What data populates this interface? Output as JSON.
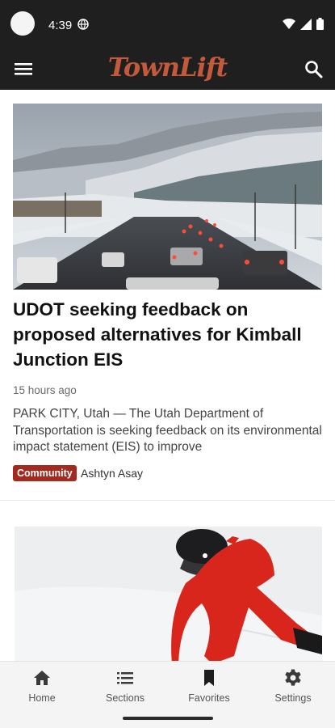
{
  "status_bar": {
    "time": "4:39"
  },
  "app_bar": {
    "logo_text": "TownLift"
  },
  "articles": [
    {
      "headline": "UDOT seeking feedback on proposed alternatives for Kimball Junction EIS",
      "time_ago": "15 hours ago",
      "excerpt": "PARK CITY, Utah — The Utah Department of Transportation is seeking feedback on its environmental impact statement (EIS) to improve",
      "category": "Community",
      "author": "Ashtyn Asay"
    }
  ],
  "bottom_nav": [
    {
      "label": "Home",
      "icon": "home-icon"
    },
    {
      "label": "Sections",
      "icon": "list-icon"
    },
    {
      "label": "Favorites",
      "icon": "bookmark-icon"
    },
    {
      "label": "Settings",
      "icon": "gear-icon"
    }
  ],
  "colors": {
    "brand": "#c45a3c",
    "tag": "#a32a1e",
    "bar": "#1f1f1f"
  }
}
